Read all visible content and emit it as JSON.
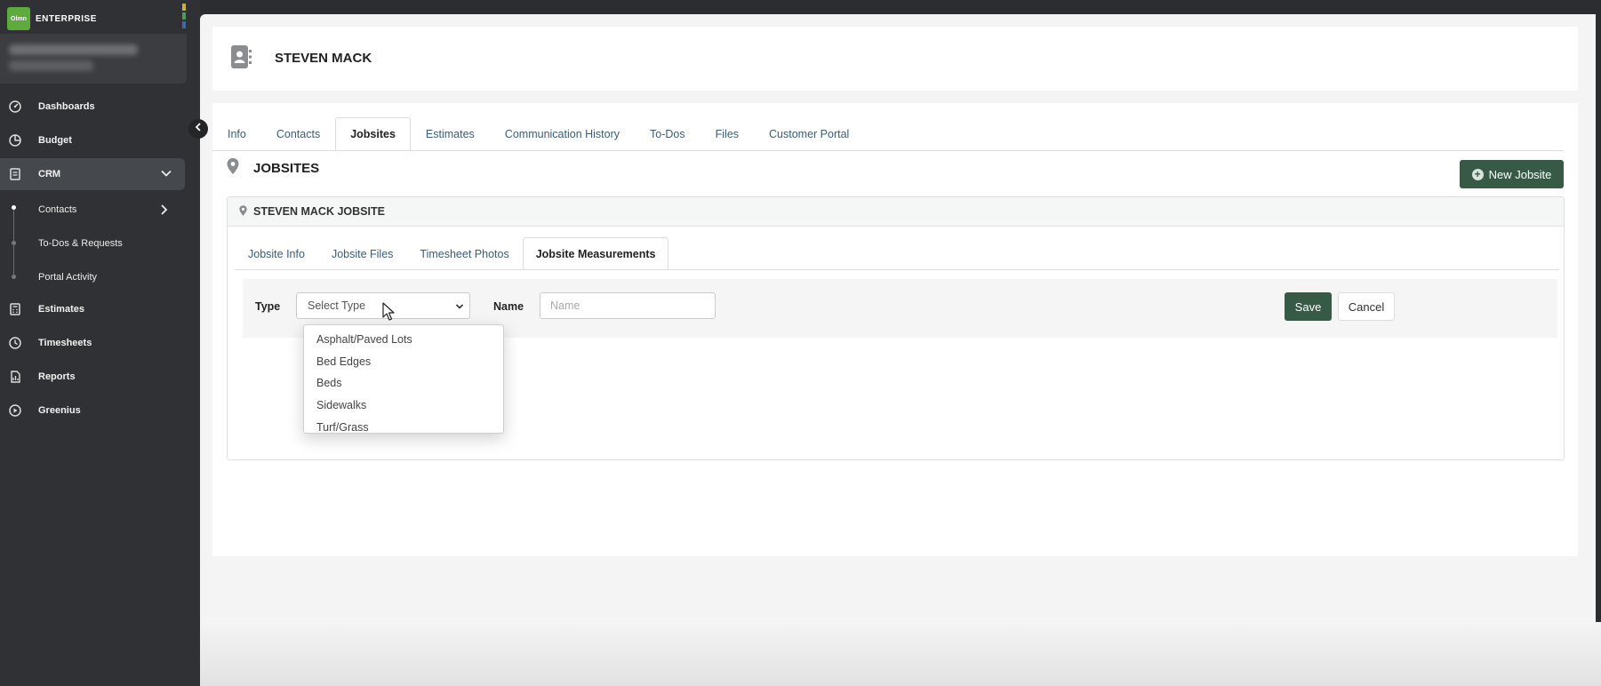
{
  "brand": {
    "logo_text": "Olmn",
    "name": "ENTERPRISE",
    "stripe_colors": [
      "#c7b33b",
      "#4a9b58",
      "#3a6aa8"
    ]
  },
  "sidebar": {
    "items": [
      {
        "label": "Dashboards",
        "icon": "dashboard-icon"
      },
      {
        "label": "Budget",
        "icon": "pie-chart-icon"
      },
      {
        "label": "CRM",
        "icon": "crm-clipboard-icon",
        "expanded": true
      },
      {
        "label": "Estimates",
        "icon": "calculator-icon"
      },
      {
        "label": "Timesheets",
        "icon": "clock-icon"
      },
      {
        "label": "Reports",
        "icon": "report-icon"
      },
      {
        "label": "Greenius",
        "icon": "play-circle-icon"
      }
    ],
    "crm_sub": [
      {
        "label": "Contacts"
      },
      {
        "label": "To-Dos & Requests"
      },
      {
        "label": "Portal Activity"
      }
    ]
  },
  "header": {
    "title": "STEVEN MACK"
  },
  "tabs": [
    {
      "label": "Info"
    },
    {
      "label": "Contacts"
    },
    {
      "label": "Jobsites",
      "active": true
    },
    {
      "label": "Estimates"
    },
    {
      "label": "Communication History"
    },
    {
      "label": "To-Dos"
    },
    {
      "label": "Files"
    },
    {
      "label": "Customer Portal"
    }
  ],
  "section": {
    "title": "JOBSITES",
    "new_button": "New Jobsite"
  },
  "jobsite": {
    "title": "STEVEN MACK JOBSITE",
    "subtabs": [
      {
        "label": "Jobsite Info"
      },
      {
        "label": "Jobsite Files"
      },
      {
        "label": "Timesheet Photos"
      },
      {
        "label": "Jobsite Measurements",
        "active": true
      }
    ]
  },
  "measurement_form": {
    "type_label": "Type",
    "type_value": "Select Type",
    "name_label": "Name",
    "name_placeholder": "Name",
    "save_label": "Save",
    "cancel_label": "Cancel",
    "type_options": [
      "Asphalt/Paved Lots",
      "Bed Edges",
      "Beds",
      "Sidewalks",
      "Turf/Grass"
    ]
  },
  "colors": {
    "sidebar_bg": "#2f3134",
    "primary_button": "#375a47",
    "link_text": "#3a5e76"
  }
}
